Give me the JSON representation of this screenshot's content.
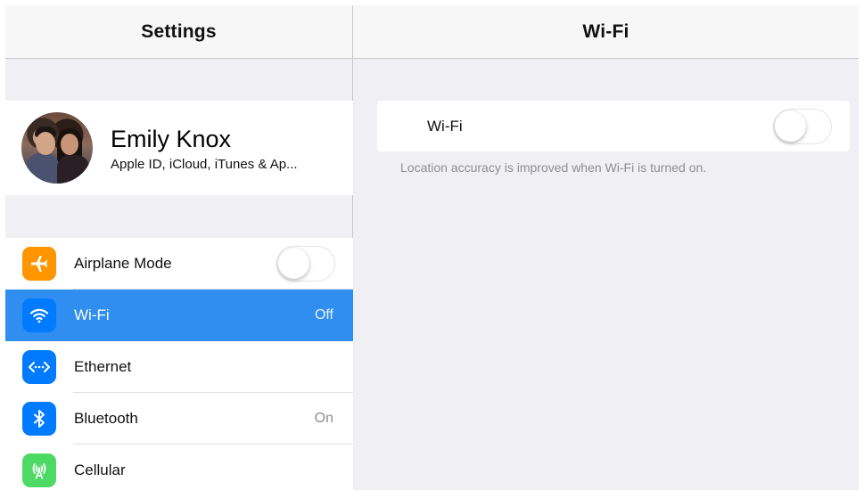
{
  "sidebar": {
    "title": "Settings",
    "profile": {
      "name": "Emily Knox",
      "subtitle": "Apple ID, iCloud, iTunes & Ap..."
    },
    "items": [
      {
        "label": "Airplane Mode",
        "icon": "airplane-icon",
        "color": "#ff9500",
        "control": "toggle",
        "value": ""
      },
      {
        "label": "Wi-Fi",
        "icon": "wifi-icon",
        "color": "#007aff",
        "control": "value",
        "value": "Off",
        "selected": true
      },
      {
        "label": "Ethernet",
        "icon": "ethernet-icon",
        "color": "#007aff",
        "control": "none",
        "value": ""
      },
      {
        "label": "Bluetooth",
        "icon": "bluetooth-icon",
        "color": "#007aff",
        "control": "value",
        "value": "On"
      },
      {
        "label": "Cellular",
        "icon": "cellular-icon",
        "color": "#4cd964",
        "control": "none",
        "value": ""
      }
    ]
  },
  "detail": {
    "title": "Wi-Fi",
    "wifi_label": "Wi-Fi",
    "wifi_enabled": false,
    "footer": "Location accuracy is improved when Wi-Fi is turned on."
  },
  "colors": {
    "selection": "#2f8ef0",
    "background": "#efeff4"
  }
}
